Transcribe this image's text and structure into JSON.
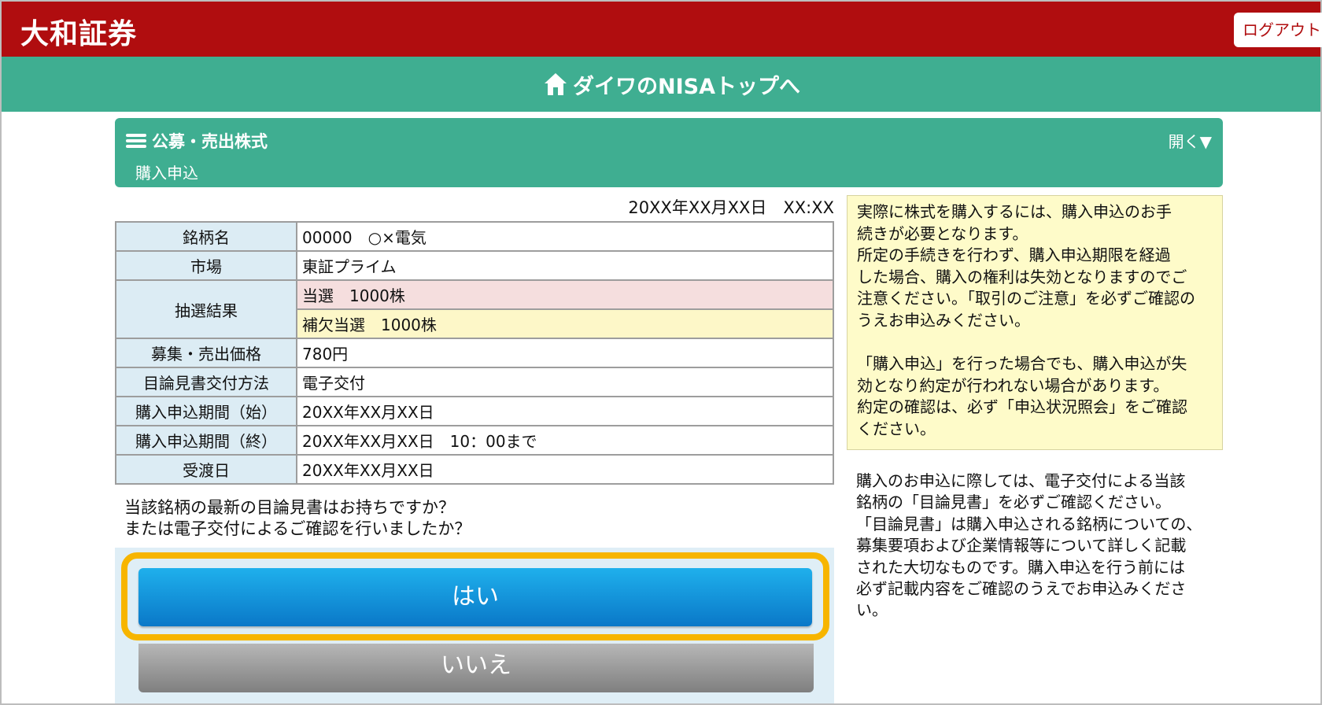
{
  "header": {
    "logo": "大和証券",
    "logout_label": "ログアウト",
    "bg_color": "#b00d0f"
  },
  "nav": {
    "nisa_link": "ダイワのNISAトップへ",
    "icon": "home-icon",
    "bg_color": "#3fae91"
  },
  "section": {
    "title": "公募・売出株式",
    "subtitle": "購入申込",
    "open_label": "開く▼",
    "menu_icon": "hamburger-icon"
  },
  "datetime": "20XX年XX月XX日　XX:XX",
  "table": {
    "stock_name": {
      "label": "銘柄名",
      "value": "00000　○×電気"
    },
    "market": {
      "label": "市場",
      "value": "東証プライム"
    },
    "lottery": {
      "label": "抽選結果",
      "win": "当選　1000株",
      "sub_win": "補欠当選　1000株"
    },
    "price": {
      "label": "募集・売出価格",
      "value": "780円"
    },
    "prospectus": {
      "label": "目論見書交付方法",
      "value": "電子交付"
    },
    "period_start": {
      "label": "購入申込期間（始）",
      "value": "20XX年XX月XX日"
    },
    "period_end": {
      "label": "購入申込期間（終）",
      "value": "20XX年XX月XX日　10：00まで"
    },
    "delivery": {
      "label": "受渡日",
      "value": "20XX年XX月XX日"
    }
  },
  "question": {
    "line1": "当該銘柄の最新の目論見書はお持ちですか？",
    "line2": "または電子交付によるご確認を行いましたか？"
  },
  "buttons": {
    "yes": "はい",
    "no": "いいえ",
    "highlight_color": "#f7b500"
  },
  "notice": {
    "p1_lines": [
      "実際に株式を購入するには、購入申込のお手",
      "続きが必要となります。",
      "所定の手続きを行わず、購入申込期限を経過",
      "した場合、購入の権利は失効となりますのでご",
      "注意ください。「取引のご注意」を必ずご確認の",
      "うえお申込みください。"
    ],
    "p2_lines": [
      "「購入申込」を行った場合でも、購入申込が失",
      "効となり約定が行われない場合があります。",
      "約定の確認は、必ず「申込状況照会」をご確認",
      "ください。"
    ]
  },
  "info_text": {
    "lines": [
      "購入のお申込に際しては、電子交付による当該",
      "銘柄の「目論見書」を必ずご確認ください。",
      "「目論見書」は購入申込される銘柄についての、",
      "募集要項および企業情報等について詳しく記載",
      "された大切なものです。購入申込を行う前には",
      "必ず記載内容をご確認のうえでお申込みくださ",
      "い。"
    ]
  }
}
